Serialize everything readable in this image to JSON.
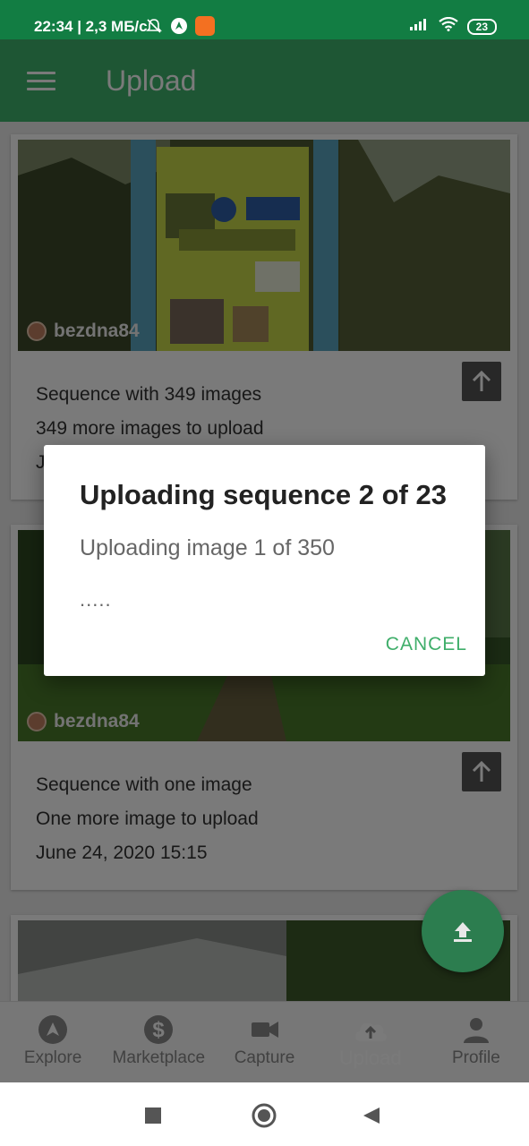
{
  "status_bar": {
    "time": "22:34 | 2,3 МБ/с",
    "battery": "23",
    "icons": [
      "bell-off-icon",
      "location-icon",
      "app-icon",
      "signal-icon",
      "wifi-icon",
      "battery-icon"
    ]
  },
  "app_bar": {
    "title": "Upload",
    "menu_icon": "menu-icon"
  },
  "sequences": [
    {
      "username": "bezdna84",
      "line1": "Sequence with 349 images",
      "line2": "349 more images to upload",
      "line3": "J"
    },
    {
      "username": "bezdna84",
      "line1": "Sequence with one image",
      "line2": "One more image to upload",
      "line3": "June 24, 2020 15:15"
    }
  ],
  "dialog": {
    "title": "Uploading sequence 2 of 23",
    "message": "Uploading image 1 of 350",
    "dots": ".....",
    "cancel_label": "CANCEL"
  },
  "bottom_nav": {
    "items": [
      {
        "label": "Explore",
        "icon": "compass-icon"
      },
      {
        "label": "Marketplace",
        "icon": "dollar-icon"
      },
      {
        "label": "Capture",
        "icon": "video-camera-icon"
      },
      {
        "label": "Upload",
        "icon": "cloud-upload-icon"
      },
      {
        "label": "Profile",
        "icon": "person-icon"
      }
    ],
    "active_label": "Upload"
  },
  "colors": {
    "status_bar": "#127d43",
    "app_bar": "#3fb56e",
    "accent": "#3fae6a",
    "fab": "#2c7d4f"
  }
}
